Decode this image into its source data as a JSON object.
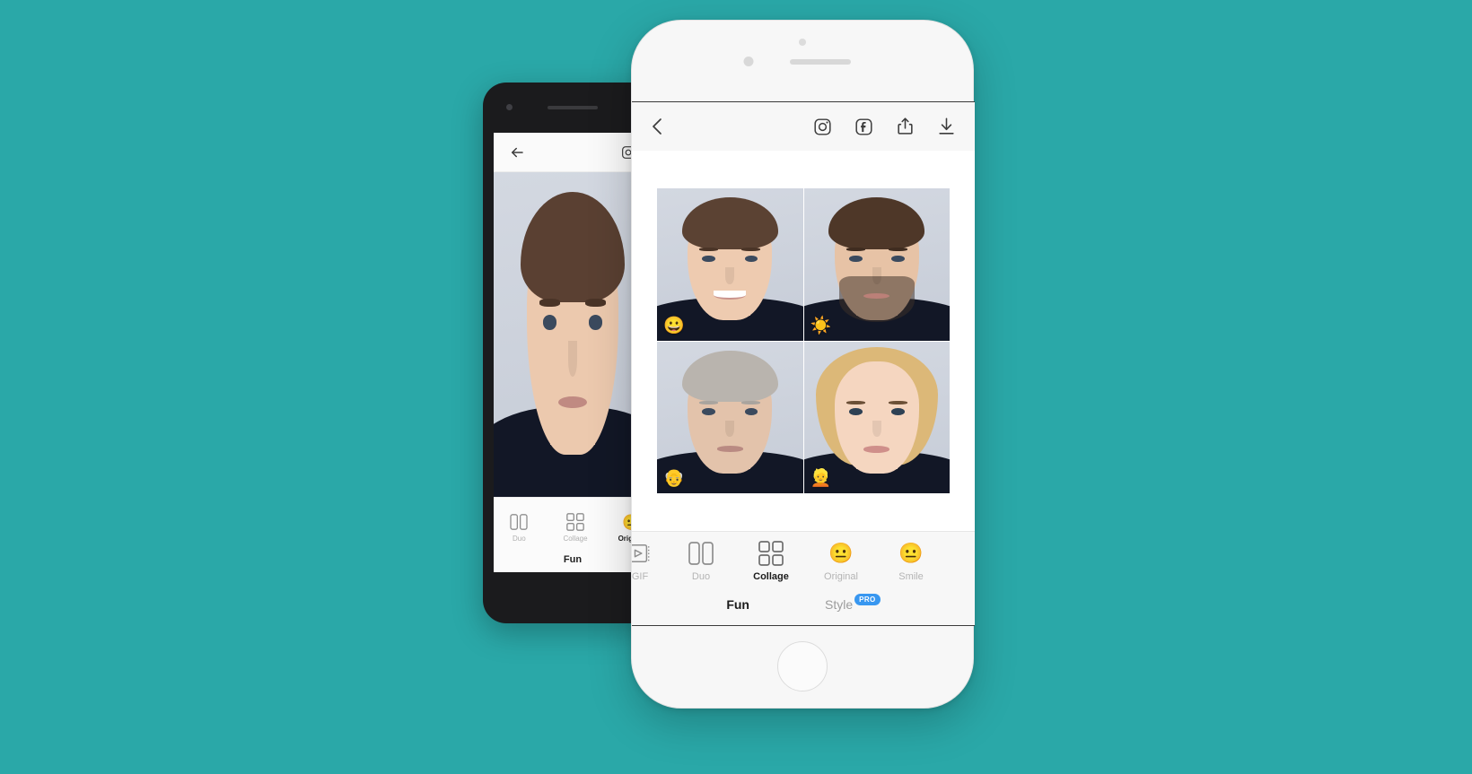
{
  "background": {
    "color": "#2aa8a8"
  },
  "android_phone": {
    "topbar": {
      "back_icon": "back-arrow-icon",
      "instagram_icon": "instagram-icon"
    },
    "tabs": [
      {
        "label": "Duo",
        "icon": "duo-split-icon",
        "active": false
      },
      {
        "label": "Collage",
        "icon": "collage-grid-icon",
        "active": false
      },
      {
        "label": "Original",
        "icon": "neutral-face-emoji",
        "active": true
      }
    ],
    "modes": [
      {
        "label": "Fun",
        "active": true
      }
    ]
  },
  "iphone": {
    "topbar": {
      "back_label": "‹",
      "actions": [
        {
          "name": "instagram-share",
          "icon": "instagram-icon"
        },
        {
          "name": "facebook-share",
          "icon": "facebook-icon"
        },
        {
          "name": "share",
          "icon": "share-up-arrow-icon"
        },
        {
          "name": "download",
          "icon": "download-arrow-icon"
        }
      ]
    },
    "collage": {
      "cells": [
        {
          "name": "smile-filter-result",
          "badge": "😀",
          "badge_name": "grinning-face-emoji",
          "variant": "smile"
        },
        {
          "name": "beard-filter-result",
          "badge": "☀️",
          "badge_name": "sun-emoji",
          "variant": "beard"
        },
        {
          "name": "old-filter-result",
          "badge": "👴",
          "badge_name": "old-man-emoji",
          "variant": "old"
        },
        {
          "name": "female-filter-result",
          "badge": "👱",
          "badge_name": "blond-person-emoji",
          "variant": "female"
        }
      ]
    },
    "tabs": [
      {
        "label": "GIF",
        "icon": "gif-film-play-icon",
        "active": false
      },
      {
        "label": "Duo",
        "icon": "duo-split-icon",
        "active": false
      },
      {
        "label": "Collage",
        "icon": "collage-grid-icon",
        "active": true
      },
      {
        "label": "Original",
        "icon": "neutral-face-emoji",
        "active": false
      },
      {
        "label": "Smile",
        "icon": "neutral-face-emoji",
        "active": false
      }
    ],
    "modes": [
      {
        "label": "Fun",
        "active": true,
        "badge": null
      },
      {
        "label": "Style",
        "active": false,
        "badge": "PRO"
      }
    ],
    "colors": {
      "pro_badge": "#3897f0",
      "active_text": "#1b1b1b",
      "inactive_text": "#b4b4b4"
    }
  }
}
